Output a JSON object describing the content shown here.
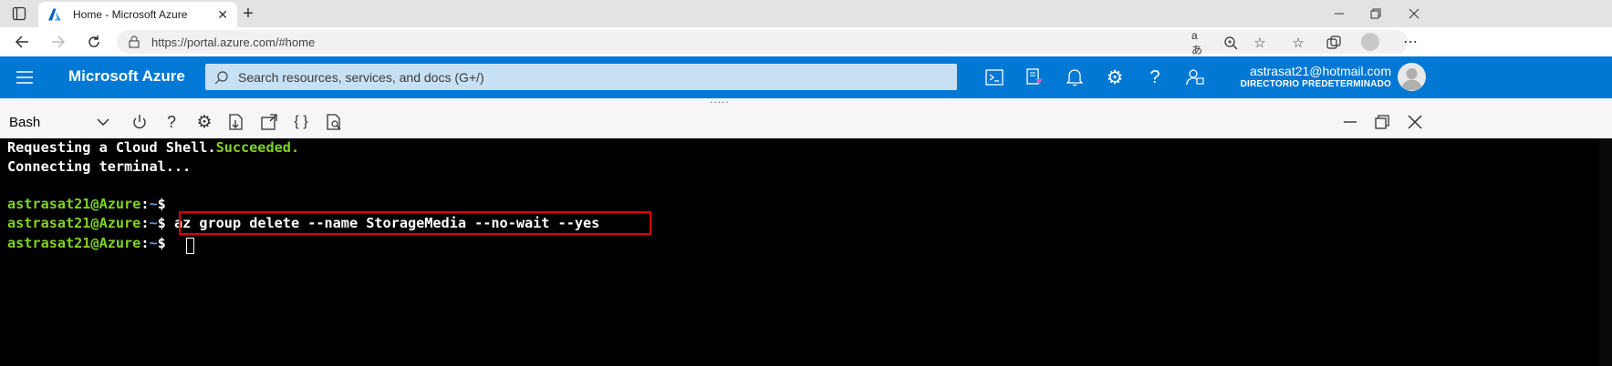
{
  "browser": {
    "tab_title": "Home - Microsoft Azure",
    "url": "https://portal.azure.com/#home",
    "new_tab_symbol": "+"
  },
  "azure": {
    "brand": "Microsoft Azure",
    "search_placeholder": "Search resources, services, and docs (G+/)",
    "account_email": "astrasat21@hotmail.com",
    "account_directory": "DIRECTORIO PREDETERMINADO"
  },
  "shell": {
    "selector": "Bash",
    "grip": "....."
  },
  "terminal": {
    "line1_text": "Requesting a Cloud Shell.",
    "line1_status": "Succeeded.",
    "line2": "Connecting terminal...",
    "prompt_user": "astrasat21@Azure",
    "prompt_sep": ":",
    "prompt_path": "~",
    "prompt_symbol": "$",
    "command": "az group delete --name StorageMedia --no-wait --yes"
  },
  "colors": {
    "azure_blue": "#0078d4",
    "prompt_green": "#7ed321",
    "highlight_red": "#e00000"
  }
}
